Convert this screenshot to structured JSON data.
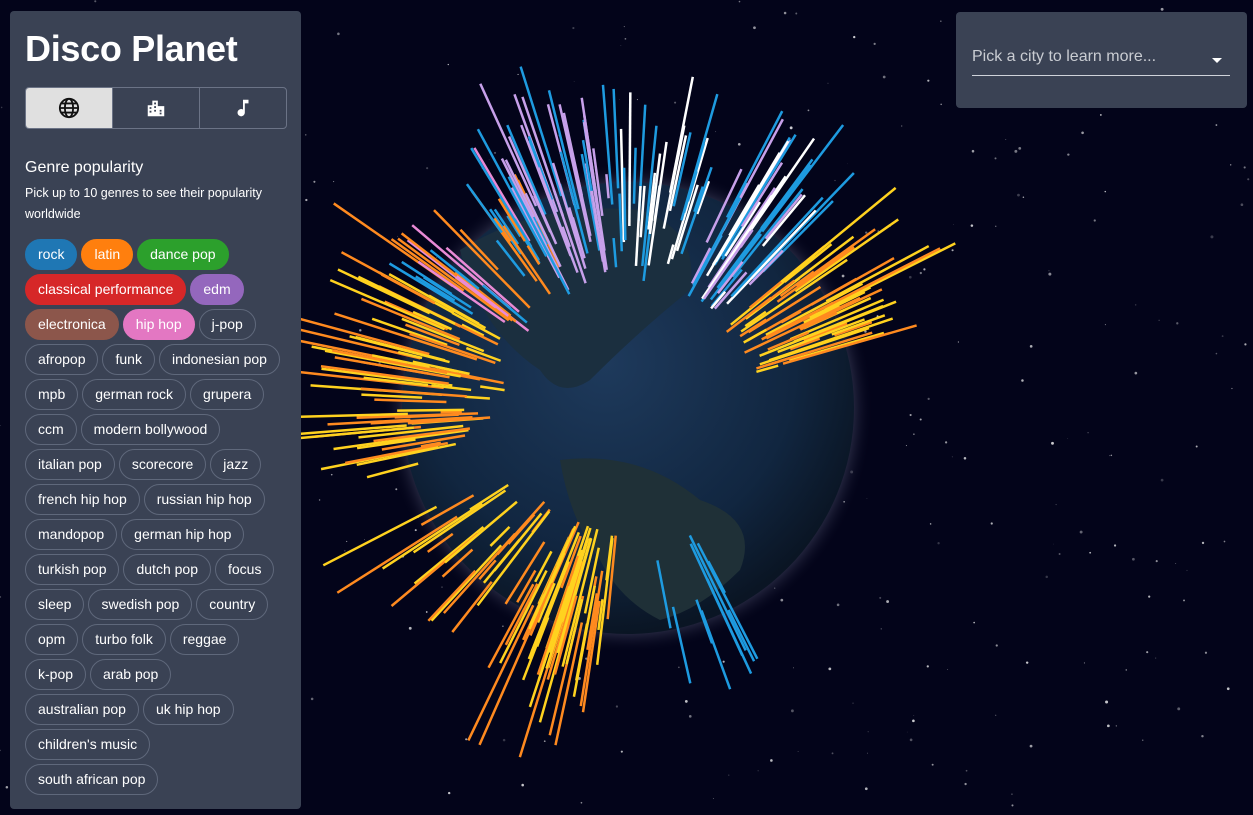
{
  "app": {
    "title": "Disco Planet"
  },
  "view_tabs": [
    {
      "icon": "globe-icon",
      "selected": true
    },
    {
      "icon": "city-icon",
      "selected": false
    },
    {
      "icon": "music-note-icon",
      "selected": false
    }
  ],
  "genre_section": {
    "title": "Genre popularity",
    "subtitle": "Pick up to 10 genres to see their popularity worldwide"
  },
  "genres": [
    {
      "label": "rock",
      "color": "#1f77b4",
      "selected": true
    },
    {
      "label": "latin",
      "color": "#ff7f0e",
      "selected": true
    },
    {
      "label": "dance pop",
      "color": "#2ca02c",
      "selected": true
    },
    {
      "label": "classical performance",
      "color": "#d62728",
      "selected": true
    },
    {
      "label": "edm",
      "color": "#9467bd",
      "selected": true
    },
    {
      "label": "electronica",
      "color": "#8c564b",
      "selected": true
    },
    {
      "label": "hip hop",
      "color": "#e377c2",
      "selected": true
    },
    {
      "label": "j-pop"
    },
    {
      "label": "afropop"
    },
    {
      "label": "funk"
    },
    {
      "label": "indonesian pop"
    },
    {
      "label": "mpb"
    },
    {
      "label": "german rock"
    },
    {
      "label": "grupera"
    },
    {
      "label": "ccm"
    },
    {
      "label": "modern bollywood"
    },
    {
      "label": "italian pop"
    },
    {
      "label": "scorecore"
    },
    {
      "label": "jazz"
    },
    {
      "label": "french hip hop"
    },
    {
      "label": "russian hip hop"
    },
    {
      "label": "mandopop"
    },
    {
      "label": "german hip hop"
    },
    {
      "label": "turkish pop"
    },
    {
      "label": "dutch pop"
    },
    {
      "label": "focus"
    },
    {
      "label": "sleep"
    },
    {
      "label": "swedish pop"
    },
    {
      "label": "country"
    },
    {
      "label": "opm"
    },
    {
      "label": "turbo folk"
    },
    {
      "label": "reggae"
    },
    {
      "label": "k-pop"
    },
    {
      "label": "arab pop"
    },
    {
      "label": "australian pop"
    },
    {
      "label": "uk hip hop"
    },
    {
      "label": "children's music"
    },
    {
      "label": "south african pop"
    }
  ],
  "city_picker": {
    "placeholder": "Pick a city to learn more..."
  },
  "spike_colors": [
    "#ff8a1f",
    "#ffd21f",
    "#1e9be0",
    "#e98ad6",
    "#c7a0ea",
    "#ffffff"
  ]
}
